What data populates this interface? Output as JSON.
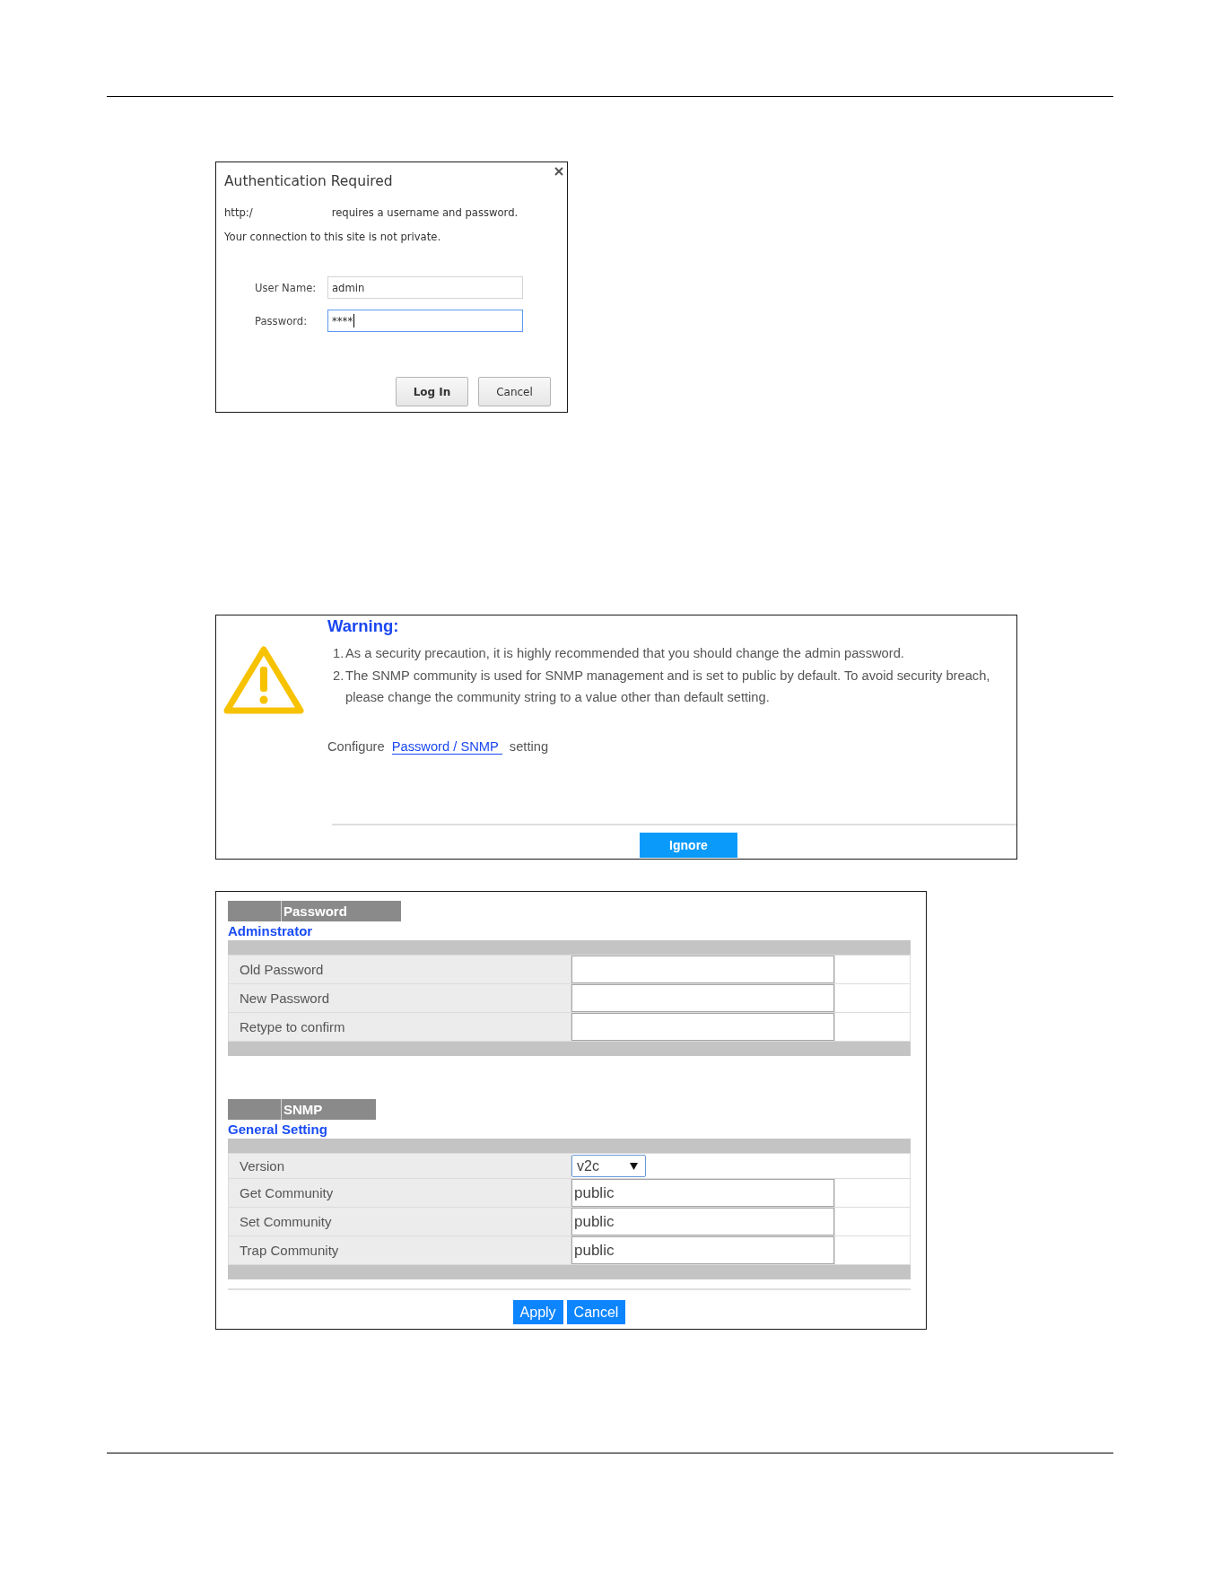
{
  "auth_dialog": {
    "title": "Authentication Required",
    "url": "http:/",
    "message": "requires a username and password.",
    "notice": "Your connection to this site is not private.",
    "fields": [
      {
        "label": "User Name:",
        "value": "admin",
        "focused": false
      },
      {
        "label": "Password:",
        "value": "****",
        "focused": true
      }
    ],
    "buttons": [
      {
        "label": "Log In",
        "default": true
      },
      {
        "label": "Cancel",
        "default": false
      }
    ]
  },
  "warning": {
    "title": "Warning:",
    "items": [
      {
        "number": "1.",
        "text": "As a security precaution, it is highly recommended that you should change the admin password."
      },
      {
        "number": "2.",
        "text": "The SNMP community is used for SNMP management and is set to public by default. To avoid security breach, please change the community string to a value other than default setting."
      }
    ],
    "configure": {
      "before": "Configure",
      "link": "Password / SNMP",
      "after": "setting"
    },
    "button": "Ignore"
  },
  "settings": {
    "sections": [
      {
        "tab": "Password",
        "heading": "Adminstrator",
        "rows": [
          {
            "kind": "input",
            "label": "Old Password"
          },
          {
            "kind": "input",
            "label": "New Password"
          },
          {
            "kind": "input",
            "label": "Retype to confirm"
          }
        ]
      },
      {
        "tab": "SNMP",
        "heading": "General Setting",
        "rows": [
          {
            "kind": "select",
            "label": "Version",
            "value": "v2c"
          },
          {
            "kind": "input",
            "label": "Get Community",
            "value": "public"
          },
          {
            "kind": "input",
            "label": "Set Community",
            "value": "public"
          },
          {
            "kind": "input",
            "label": "Trap Community",
            "value": "public"
          }
        ]
      }
    ],
    "buttons": [
      "Apply",
      "Cancel"
    ]
  }
}
